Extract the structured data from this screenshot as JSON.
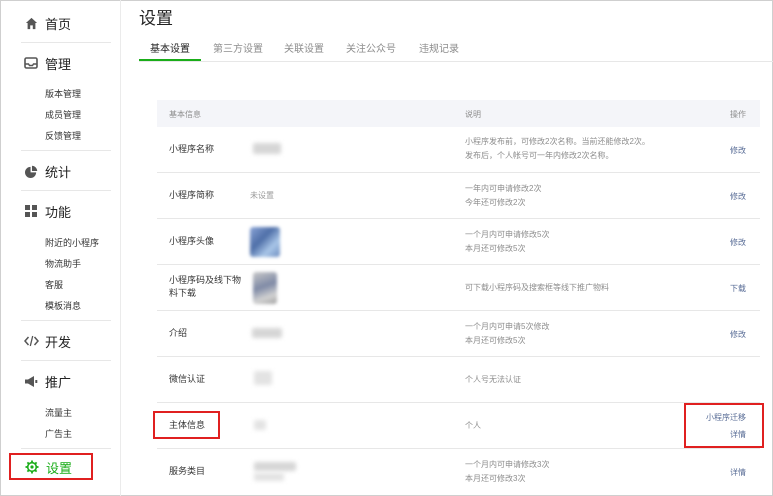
{
  "sidebar": {
    "home": "首页",
    "manage": "管理",
    "manage_items": [
      "版本管理",
      "成员管理",
      "反馈管理"
    ],
    "stats": "统计",
    "features": "功能",
    "feature_items": [
      "附近的小程序",
      "物流助手",
      "客服",
      "模板消息"
    ],
    "develop": "开发",
    "promote": "推广",
    "promote_items": [
      "流量主",
      "广告主"
    ],
    "settings": "设置"
  },
  "page": {
    "title": "设置",
    "tabs": [
      "基本设置",
      "第三方设置",
      "关联设置",
      "关注公众号",
      "违规记录"
    ],
    "active_tab": "基本设置"
  },
  "table": {
    "headers": {
      "info": "基本信息",
      "desc": "说明",
      "op": "操作"
    },
    "rows": [
      {
        "label": "小程序名称",
        "value": "",
        "desc": [
          "小程序发布前，可修改2次名称。当前还能修改2次。",
          "发布后，个人帐号可一年内修改2次名称。"
        ],
        "op": [
          "修改"
        ]
      },
      {
        "label": "小程序简称",
        "value": "未设置",
        "desc": [
          "一年内可申请修改2次",
          "今年还可修改2次"
        ],
        "op": [
          "修改"
        ]
      },
      {
        "label": "小程序头像",
        "value": "",
        "desc": [
          "一个月内可申请修改5次",
          "本月还可修改5次"
        ],
        "op": [
          "修改"
        ]
      },
      {
        "label": "小程序码及线下物料下载",
        "value": "",
        "desc": [
          "可下载小程序码及搜索框等线下推广物料"
        ],
        "op": [
          "下载"
        ]
      },
      {
        "label": "介绍",
        "value": "",
        "desc": [
          "一个月内可申请5次修改",
          "本月还可修改5次"
        ],
        "op": [
          "修改"
        ]
      },
      {
        "label": "微信认证",
        "value": "",
        "desc": [
          "个人号无法认证"
        ],
        "op": []
      },
      {
        "label": "主体信息",
        "value": "",
        "desc": [
          "个人"
        ],
        "op": [
          "小程序迁移",
          "详情"
        ]
      },
      {
        "label": "服务类目",
        "value": "",
        "desc": [
          "一个月内可申请修改3次",
          "本月还可修改3次"
        ],
        "op": [
          "详情"
        ]
      }
    ]
  },
  "colors": {
    "accent": "#1aad19",
    "link": "#576b95",
    "highlight": "#e02020"
  },
  "icons": [
    "home-icon",
    "inbox-icon",
    "pie-chart-icon",
    "grid-icon",
    "code-icon",
    "megaphone-icon",
    "gear-icon"
  ]
}
